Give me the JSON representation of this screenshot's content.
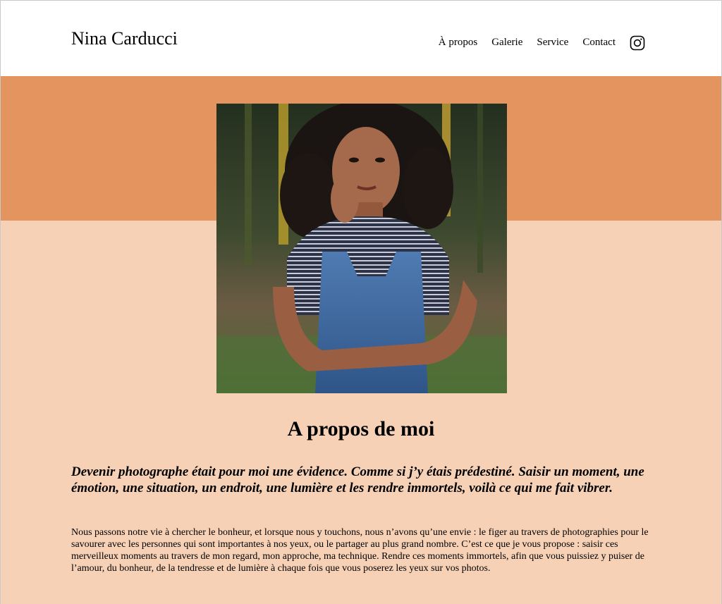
{
  "header": {
    "brand": "Nina Carducci",
    "nav": [
      {
        "label": "À propos"
      },
      {
        "label": "Galerie"
      },
      {
        "label": "Service"
      },
      {
        "label": "Contact"
      }
    ],
    "social_icon": "instagram-icon"
  },
  "about": {
    "portrait_alt": "Nina Carducci",
    "title": "A propos de moi",
    "lead": "Devenir photographe était pour moi une évidence. Comme si j’y étais prédestiné. Saisir un moment, une émotion, une situation, un endroit, une lumière et les rendre immortels, voilà ce qui me fait vibrer.",
    "body": "Nous passons notre vie à chercher le bonheur, et lorsque nous y touchons, nous n’avons qu’une envie : le figer au travers de photographies pour le savourer avec les personnes qui sont importantes à nos yeux, ou le partager au plus grand nombre. C’est ce que je vous propose : saisir ces merveilleux moments au travers de mon regard, mon approche, ma technique. Rendre ces moments immortels, afin que vous puissiez y puiser de l’amour, du bonheur, de la tendresse et de lumière à chaque fois que vous poserez les yeux sur vos photos."
  },
  "colors": {
    "header_bg": "#ffffff",
    "accent_band": "#e4955f",
    "page_bg": "#f6d1b6",
    "text": "#000000"
  }
}
